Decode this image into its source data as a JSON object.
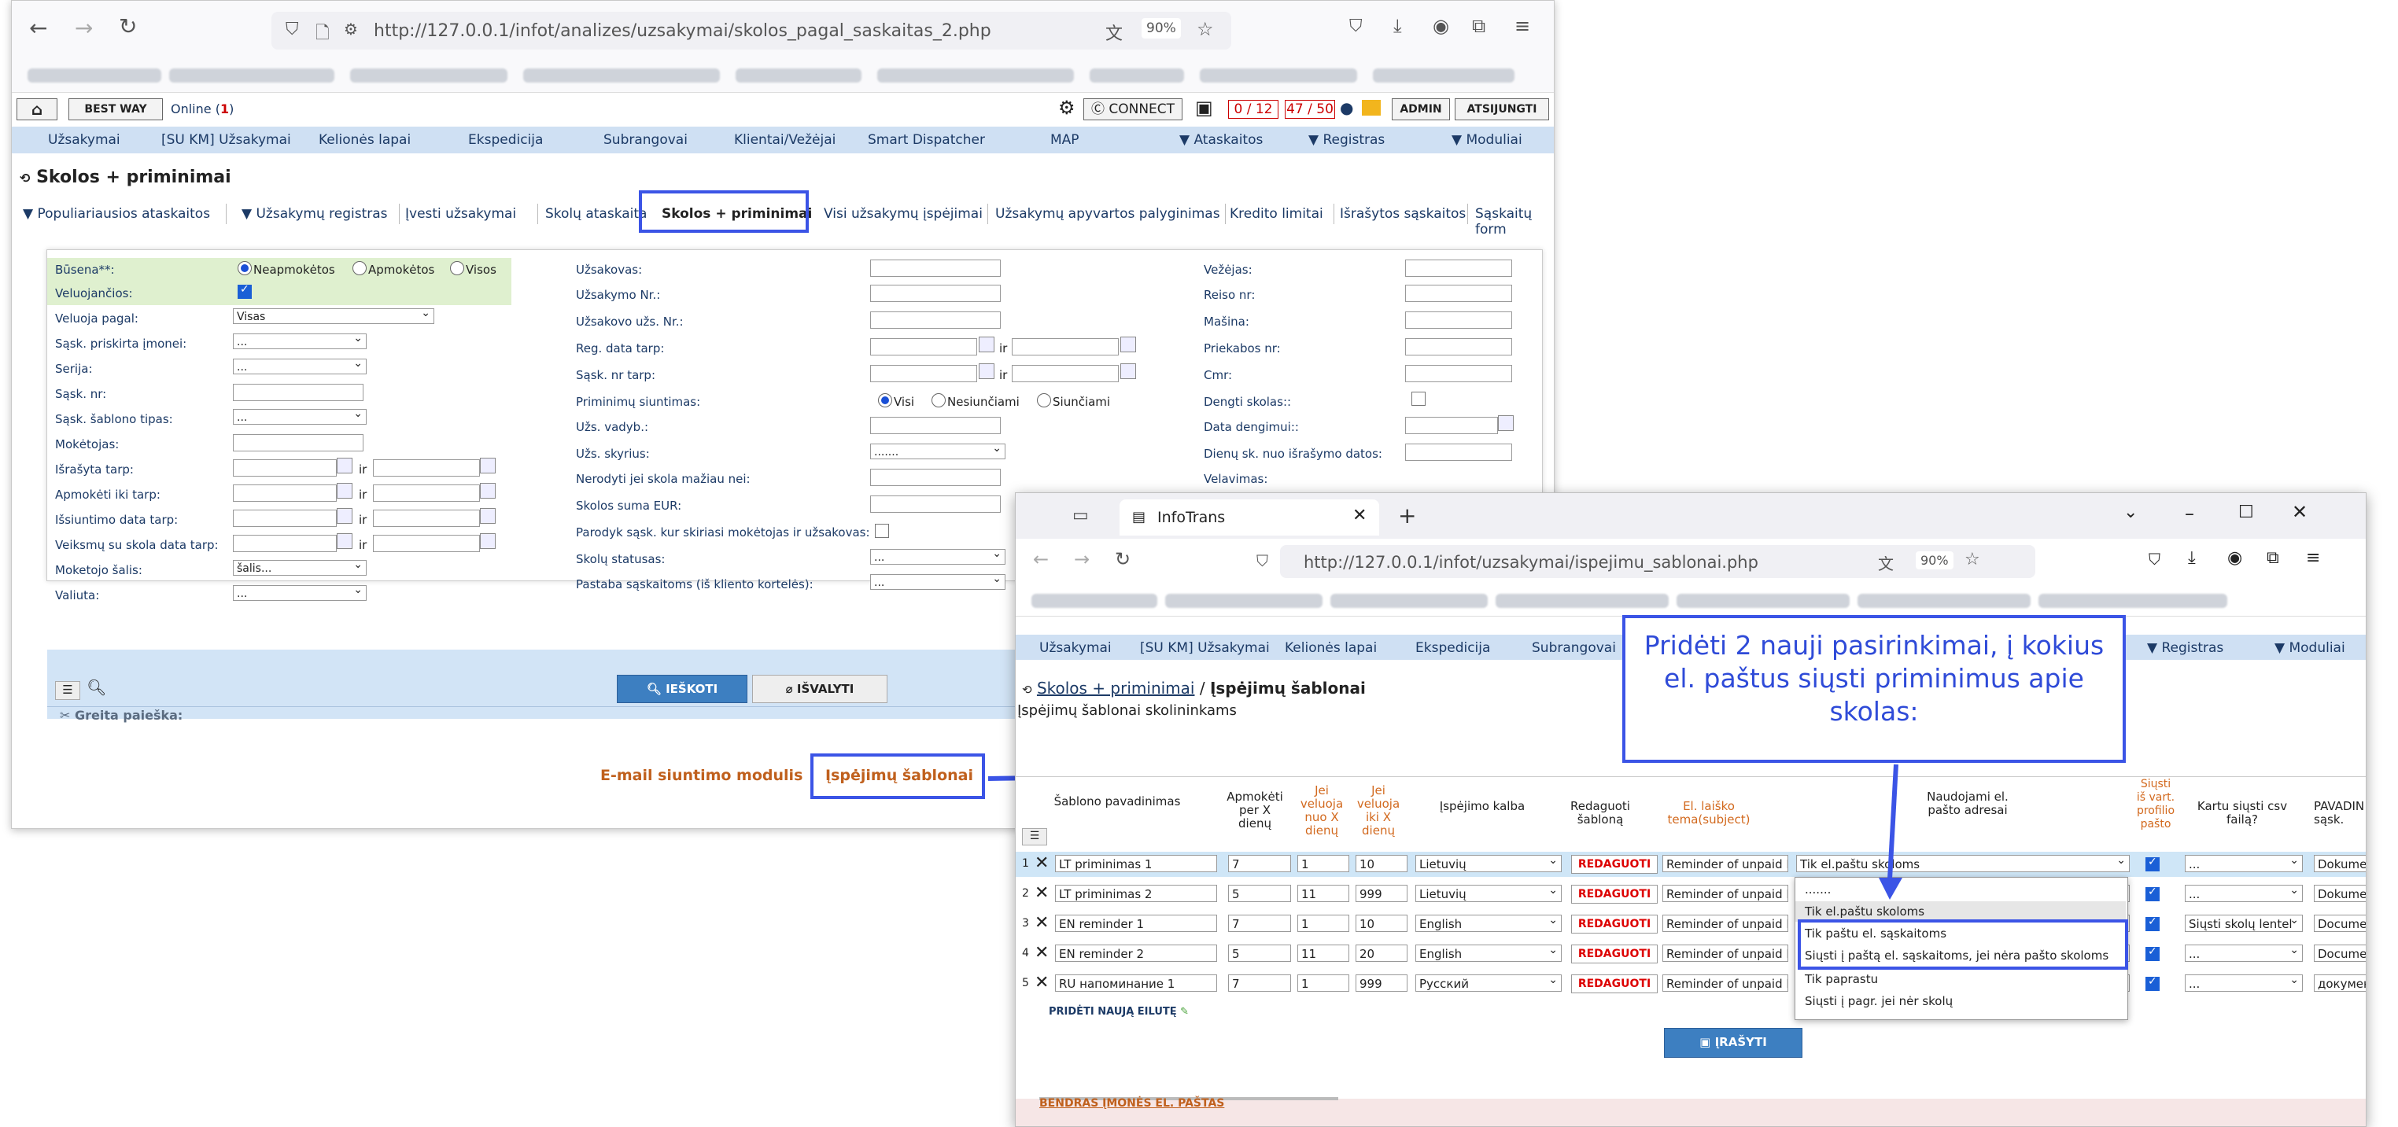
{
  "window1": {
    "url": "http://127.0.0.1/infot/analizes/uzsakymai/skolos_pagal_saskaitas_2.php",
    "zoom": "90%",
    "header": {
      "best_way": "BEST WAY",
      "online_label": "Online (",
      "online_count": "1",
      "online_close": ")",
      "connect": "CONNECT",
      "counter1": "0 / 12",
      "counter2": "47 / 50",
      "admin": "ADMIN",
      "logout": "ATSIJUNGTI"
    },
    "menu": [
      "Užsakymai",
      "[SU KM] Užsakymai",
      "Kelionės lapai",
      "Ekspedicija",
      "Subrangovai",
      "Klientai/Vežėjai",
      "Smart Dispatcher",
      "MAP",
      "▼ Ataskaitos",
      "▼ Registras",
      "▼ Moduliai"
    ],
    "page_title": "Skolos + priminimai",
    "tabs": [
      "▼ Populiariausios ataskaitos",
      "▼ Užsakymų registras",
      "Įvesti užsakymai",
      "Skolų ataskaita",
      "Skolos + priminimai",
      "Visi užsakymų įspėjimai",
      "Užsakymų apyvartos palyginimas",
      "Kredito limitai",
      "Išrašytos sąskaitos",
      "Sąskaitų form"
    ],
    "form": {
      "col1": [
        "Būsena**:",
        "Veluojančios:",
        "Veluoja pagal:",
        "Sąsk. priskirta įmonei:",
        "Serija:",
        "Sąsk. nr:",
        "Sąsk. šablono tipas:",
        "Mokėtojas:",
        "Išrašyta tarp:",
        "Apmokėti iki tarp:",
        "Išsiuntimo data tarp:",
        "Veiksmų su skola data tarp:",
        "Moketojo šalis:",
        "Valiuta:"
      ],
      "status_options": [
        "Neapmokėtos",
        "Apmokėtos",
        "Visos"
      ],
      "veluoja_pagal_value": "Visas",
      "dots": "...",
      "salis_value": "šalis...",
      "ir": "ir",
      "col2": [
        "Užsakovas:",
        "Užsakymo Nr.:",
        "Užsakovo užs. Nr.:",
        "Reg. data tarp:",
        "Sąsk. nr tarp:",
        "Priminimų siuntimas:",
        "Užs. vadyb.:",
        "Užs. skyrius:",
        "Nerodyti jei skola mažiau nei:",
        "Skolos suma EUR:",
        "Parodyk sąsk. kur skiriasi mokėtojas ir užsakovas:",
        "Skolų statusas:",
        "Pastaba sąskaitoms (iš kliento kortelės):"
      ],
      "reminder_options": [
        "Visi",
        "Nesiunčiami",
        "Siunčiami"
      ],
      "skyrius_value": ".......",
      "col3": [
        "Vežėjas:",
        "Reiso nr:",
        "Mašina:",
        "Priekabos nr:",
        "Cmr:",
        "Dengti skolas::",
        "Data dengimui::",
        "Dienų sk. nuo išrašymo datos:",
        "Velavimas:"
      ],
      "search_btn": "IEŠKOTI",
      "clear_btn": "IŠVALYTI",
      "quick_search": "Greita paieška:"
    },
    "email_module": "E-mail siuntimo modulis",
    "templates_link": "Įspėjimų šablonai"
  },
  "window2": {
    "tab_title": "InfoTrans",
    "url": "http://127.0.0.1/infot/uzsakymai/ispejimu_sablonai.php",
    "zoom": "90%",
    "menu": [
      "Užsakymai",
      "[SU KM] Užsakymai",
      "Kelionės lapai",
      "Ekspedicija",
      "Subrangovai",
      "▼ Registras",
      "▼ Moduliai"
    ],
    "breadcrumb_parent": "Skolos + priminimai",
    "breadcrumb_sep": "/",
    "breadcrumb_current": "Įspėjimų šablonai",
    "subtitle": "Įspėjimų šablonai skolininkams",
    "columns": [
      "Šablono pavadinimas",
      "Apmokėti per X dienų",
      "Jei veluoja nuo X dienų",
      "Jei veluoja iki X dienų",
      "Įspėjimo kalba",
      "Redaguoti šabloną",
      "El. laiško tema(subject)",
      "Naudojami el. pašto adresai",
      "Siųsti iš vart. profilio pašto",
      "Kartu siųsti csv failą?",
      "PAVADIN sąsk."
    ],
    "rows": [
      {
        "n": "1",
        "name": "LT priminimas 1",
        "pay": "7",
        "from": "1",
        "to": "10",
        "lang": "Lietuvių",
        "edit": "REDAGUOTI",
        "subject": "Reminder of unpaid I",
        "emails": "Tik el.paštu skoloms",
        "csv": "...",
        "doc": "Dokumen"
      },
      {
        "n": "2",
        "name": "LT priminimas 2",
        "pay": "5",
        "from": "11",
        "to": "999",
        "lang": "Lietuvių",
        "edit": "REDAGUOTI",
        "subject": "Reminder of unpaid I",
        "emails": "",
        "csv": "...",
        "doc": "Dokumen"
      },
      {
        "n": "3",
        "name": "EN reminder 1",
        "pay": "7",
        "from": "1",
        "to": "10",
        "lang": "English",
        "edit": "REDAGUOTI",
        "subject": "Reminder of unpaid I",
        "emails": "",
        "csv": "Siųsti skolų lentel",
        "doc": "Documen"
      },
      {
        "n": "4",
        "name": "EN reminder 2",
        "pay": "5",
        "from": "11",
        "to": "20",
        "lang": "English",
        "edit": "REDAGUOTI",
        "subject": "Reminder of unpaid I",
        "emails": "",
        "csv": "...",
        "doc": "Documen"
      },
      {
        "n": "5",
        "name": "RU напоминание 1",
        "pay": "7",
        "from": "1",
        "to": "999",
        "lang": "Русский",
        "edit": "REDAGUOTI",
        "subject": "Reminder of unpaid I",
        "emails": "",
        "csv": "...",
        "doc": "документ"
      }
    ],
    "dropdown_options": [
      ".......",
      "Tik el.paštu skoloms",
      "Tik paštu el. sąskaitoms",
      "Siųsti į paštą el. sąskaitoms, jei nėra pašto skoloms",
      "Tik paprastu",
      "Siųsti į pagr. jei nėr skolų"
    ],
    "add_row": "PRIDĖTI NAUJĄ EILUTĘ",
    "save_btn": "ĮRAŠYTI",
    "bottom_label": "BENDRAS ĮMONĖS EL. PAŠTAS"
  },
  "callout": "Pridėti 2 nauji pasirinkimai, į kokius el. paštus siųsti priminimus apie skolas:",
  "colors": {
    "accent": "#3b54e6",
    "menu_bg": "#cfe0f3",
    "orange": "#d2691e",
    "red": "#d00000"
  }
}
